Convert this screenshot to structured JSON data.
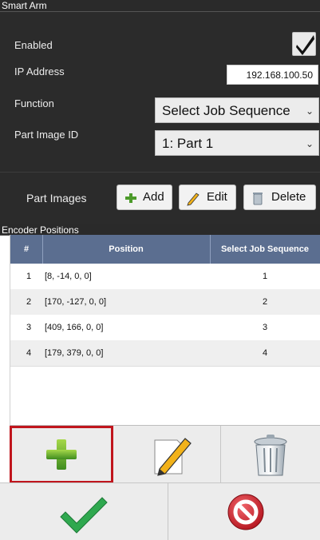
{
  "smart_arm": {
    "title": "Smart Arm",
    "enabled_label": "Enabled",
    "enabled_checked": true,
    "ip_label": "IP Address",
    "ip_value": "192.168.100.50",
    "function_label": "Function",
    "function_value": "Select Job Sequence",
    "part_image_label": "Part Image ID",
    "part_image_value": "1: Part 1",
    "part_images_label": "Part Images",
    "add_label": "Add",
    "edit_label": "Edit",
    "delete_label": "Delete"
  },
  "encoder": {
    "title": "Encoder Positions",
    "columns": [
      "#",
      "Position",
      "Select Job Sequence"
    ],
    "rows": [
      {
        "num": "1",
        "position": "[8, -14, 0, 0]",
        "sequence": "1"
      },
      {
        "num": "2",
        "position": "[170, -127, 0, 0]",
        "sequence": "2"
      },
      {
        "num": "3",
        "position": "[409, 166, 0, 0]",
        "sequence": "3"
      },
      {
        "num": "4",
        "position": "[179, 379, 0, 0]",
        "sequence": "4"
      }
    ]
  },
  "toolbar": {
    "add_icon": "plus-icon",
    "edit_icon": "pencil-icon",
    "delete_icon": "trash-icon",
    "ok_icon": "checkmark-icon",
    "cancel_icon": "cancel-icon"
  },
  "colors": {
    "panel_bg": "#2b2b2b",
    "table_header": "#5b6e90",
    "highlight_border": "#c0151d",
    "green": "#2fa84f",
    "red": "#c8202a"
  }
}
